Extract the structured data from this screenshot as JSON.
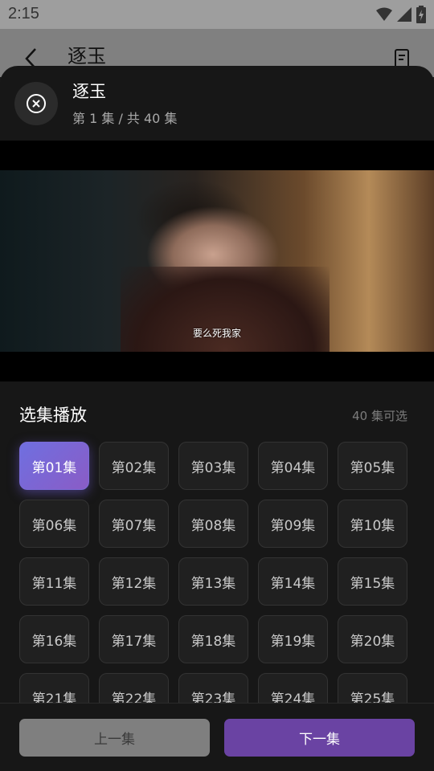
{
  "status_bar": {
    "time": "2:15"
  },
  "underlay": {
    "title": "逐玉"
  },
  "sheet": {
    "title": "逐玉",
    "episode_info": "第 1 集 / 共 40 集"
  },
  "video": {
    "subtitle": "要么死我家"
  },
  "episodes": {
    "section_title": "选集播放",
    "count_label": "40 集可选",
    "items": [
      "第01集",
      "第02集",
      "第03集",
      "第04集",
      "第05集",
      "第06集",
      "第07集",
      "第08集",
      "第09集",
      "第10集",
      "第11集",
      "第12集",
      "第13集",
      "第14集",
      "第15集",
      "第16集",
      "第17集",
      "第18集",
      "第19集",
      "第20集",
      "第21集",
      "第22集",
      "第23集",
      "第24集",
      "第25集"
    ],
    "active_index": 0
  },
  "actions": {
    "prev_label": "上一集",
    "next_label": "下一集"
  },
  "colors": {
    "accent": "#6a43a3",
    "active_start": "#6f6fe0",
    "active_end": "#8a5cc6"
  }
}
